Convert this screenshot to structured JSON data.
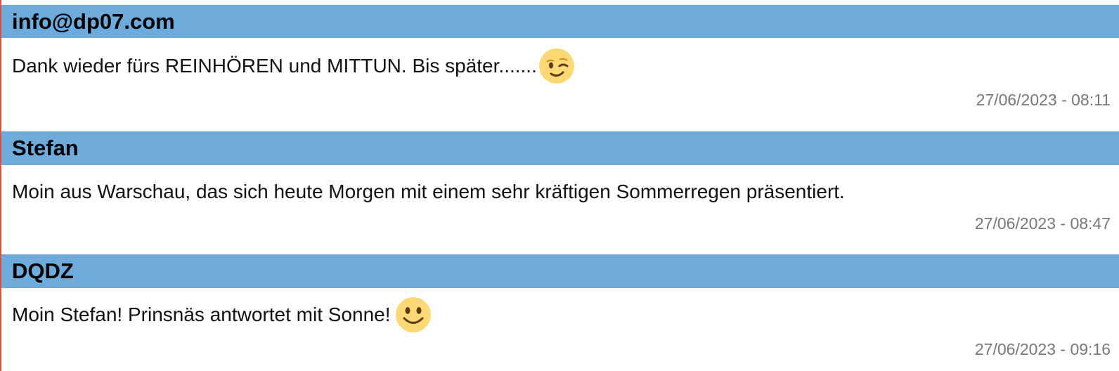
{
  "entries": [
    {
      "author": "info@dp07.com",
      "message": "Dank wieder fürs REINHÖREN und MITTUN. Bis später.......",
      "emoji": "winking-face-icon",
      "date": "27/06/2023 - 08:11"
    },
    {
      "author": "Stefan",
      "message": "Moin aus Warschau, das sich heute Morgen mit einem sehr kräftigen Sommerregen präsentiert.",
      "emoji": null,
      "date": "27/06/2023 - 08:47"
    },
    {
      "author": "DQDZ",
      "message": "Moin Stefan! Prinsnäs antwortet mit Sonne! ",
      "emoji": "smiling-face-icon",
      "date": "27/06/2023 - 09:16"
    }
  ],
  "colors": {
    "header_background": "#6eabdd",
    "left_border": "#d9533b",
    "date_text": "#777777",
    "emoji_face": "#fcd975"
  }
}
